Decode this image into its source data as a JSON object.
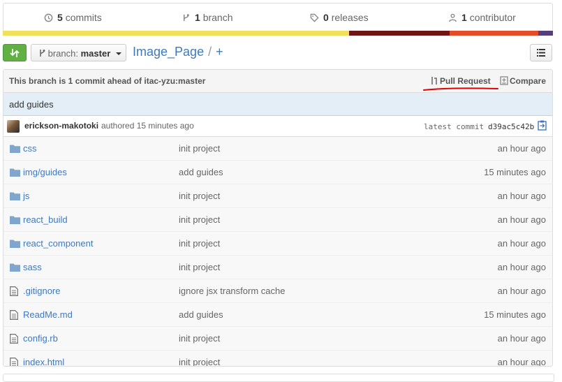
{
  "summary": {
    "commits_count": "5",
    "commits_label": "commits",
    "branches_count": "1",
    "branches_label": "branch",
    "releases_count": "0",
    "releases_label": "releases",
    "contributors_count": "1",
    "contributors_label": "contributor"
  },
  "language_colors": [
    "#f1e05a",
    "#701516",
    "#e34c26",
    "#563d7c"
  ],
  "toolbar": {
    "branch_prefix": "branch:",
    "branch_name": "master",
    "repo_name": "Image_Page",
    "separator": "/",
    "new_file": "+"
  },
  "ahead_bar": {
    "message": "This branch is 1 commit ahead of itac-yzu:master",
    "pull_request": "Pull Request",
    "compare": "Compare"
  },
  "last_commit": {
    "message": "add guides",
    "author": "erickson-makotoki",
    "authored": "authored 15 minutes ago",
    "latest_label": "latest commit",
    "sha": "d39ac5c42b"
  },
  "files": [
    {
      "name": "css",
      "type": "dir",
      "message": "init project",
      "age": "an hour ago"
    },
    {
      "name": "img/guides",
      "type": "dir",
      "message": "add guides",
      "age": "15 minutes ago"
    },
    {
      "name": "js",
      "type": "dir",
      "message": "init project",
      "age": "an hour ago"
    },
    {
      "name": "react_build",
      "type": "dir",
      "message": "init project",
      "age": "an hour ago"
    },
    {
      "name": "react_component",
      "type": "dir",
      "message": "init project",
      "age": "an hour ago"
    },
    {
      "name": "sass",
      "type": "dir",
      "message": "init project",
      "age": "an hour ago"
    },
    {
      "name": ".gitignore",
      "type": "file",
      "message": "ignore jsx transform cache",
      "age": "an hour ago"
    },
    {
      "name": "ReadMe.md",
      "type": "file",
      "message": "add guides",
      "age": "15 minutes ago"
    },
    {
      "name": "config.rb",
      "type": "file",
      "message": "init project",
      "age": "an hour ago"
    },
    {
      "name": "index.html",
      "type": "file",
      "message": "init project",
      "age": "an hour ago"
    }
  ],
  "colors": {
    "link": "#4078c0",
    "compare_button": "#60b044",
    "annotation": "#e00000"
  }
}
